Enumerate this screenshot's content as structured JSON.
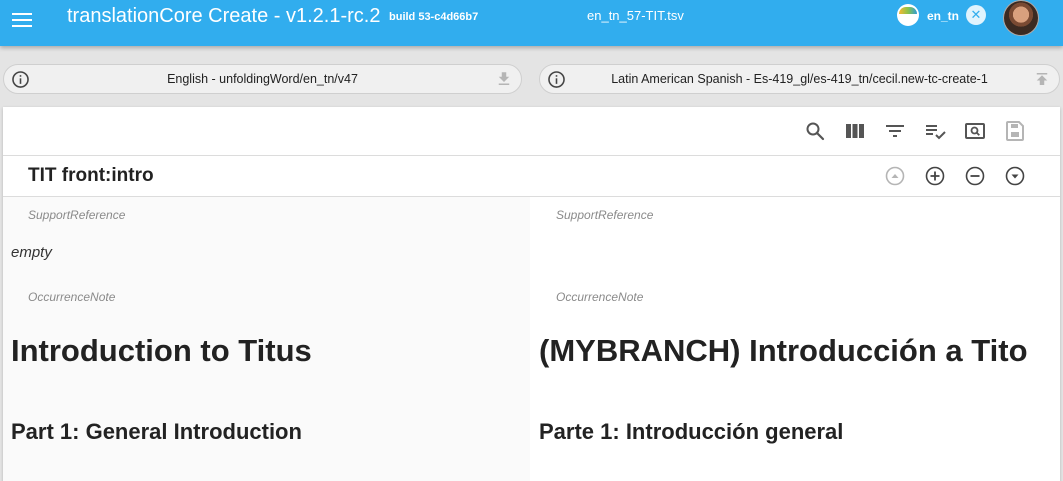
{
  "appbar": {
    "title": "translationCore Create - v1.2.1-rc.2",
    "build": "build 53-c4d66b7",
    "file_name": "en_tn_57-TIT.tsv",
    "org_name": "en_tn",
    "clear_glyph": "✕"
  },
  "resources": {
    "source": {
      "label": "English - unfoldingWord/en_tn/v47",
      "icon": "info-icon",
      "action_icon": "download-icon"
    },
    "target": {
      "label": "Latin American Spanish - Es-419_gl/es-419_tn/cecil.new-tc-create-1",
      "icon": "info-icon",
      "action_icon": "upload-icon"
    }
  },
  "toolbar": {
    "icons": [
      "search-icon",
      "columns-icon",
      "filter-icon",
      "validate-icon",
      "preview-icon",
      "save-icon"
    ]
  },
  "reference": {
    "title": "TIT front:intro",
    "nav_icons": [
      "move-up-icon",
      "add-row-icon",
      "delete-row-icon",
      "move-down-icon"
    ]
  },
  "source_col": {
    "support_label": "SupportReference",
    "support_value": "empty",
    "note_label": "OccurrenceNote",
    "heading1": "Introduction to Titus",
    "heading2": "Part 1: General Introduction"
  },
  "target_col": {
    "support_label": "SupportReference",
    "support_value": "",
    "note_label": "OccurrenceNote",
    "heading1": "(MYBRANCH) Introducción a Tito",
    "heading2": "Parte 1: Introducción general"
  },
  "colors": {
    "appbar": "#31adee",
    "icon_gray": "#555555",
    "disabled_gray": "#b5b5b5"
  }
}
